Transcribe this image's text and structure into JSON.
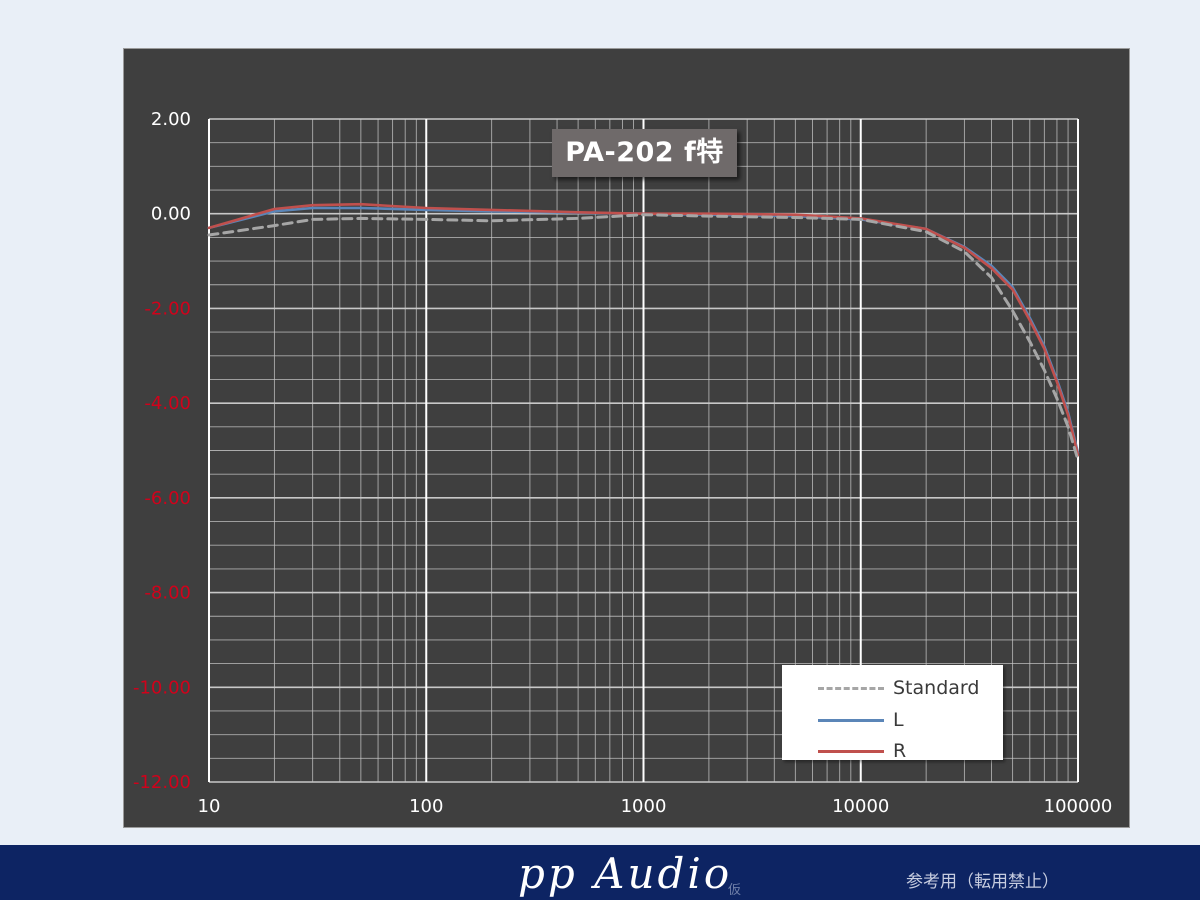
{
  "chart_data": {
    "type": "line",
    "title": "PA-202  f特",
    "x_scale": "log",
    "xlim": [
      10,
      100000
    ],
    "ylim": [
      -12,
      2
    ],
    "x_ticks": [
      "10",
      "100",
      "1000",
      "10000",
      "100000"
    ],
    "y_ticks": [
      {
        "value": 2,
        "label": "2.00",
        "color": "#ffffff"
      },
      {
        "value": 0,
        "label": "0.00",
        "color": "#ffffff"
      },
      {
        "value": -2,
        "label": "-2.00",
        "color": "#d0021b"
      },
      {
        "value": -4,
        "label": "-4.00",
        "color": "#d0021b"
      },
      {
        "value": -6,
        "label": "-6.00",
        "color": "#d0021b"
      },
      {
        "value": -8,
        "label": "-8.00",
        "color": "#d0021b"
      },
      {
        "value": -10,
        "label": "-10.00",
        "color": "#d0021b"
      },
      {
        "value": -12,
        "label": "-12.00",
        "color": "#d0021b"
      }
    ],
    "grid": true,
    "legend_position": "bottom-right",
    "series": [
      {
        "name": "Standard",
        "color": "#a6a6a6",
        "dash": true,
        "x": [
          10,
          20,
          30,
          50,
          100,
          200,
          500,
          1000,
          2000,
          5000,
          10000,
          20000,
          30000,
          40000,
          50000,
          60000,
          70000,
          80000,
          90000,
          100000
        ],
        "y": [
          -0.45,
          -0.25,
          -0.12,
          -0.1,
          -0.12,
          -0.15,
          -0.1,
          -0.02,
          -0.05,
          -0.08,
          -0.12,
          -0.38,
          -0.8,
          -1.35,
          -2.05,
          -2.7,
          -3.3,
          -3.9,
          -4.5,
          -5.2
        ]
      },
      {
        "name": "L",
        "color": "#5b86b8",
        "dash": false,
        "x": [
          10,
          20,
          30,
          50,
          100,
          200,
          500,
          1000,
          2000,
          5000,
          10000,
          20000,
          30000,
          40000,
          50000,
          60000,
          70000,
          80000,
          90000,
          100000
        ],
        "y": [
          -0.3,
          0.05,
          0.12,
          0.12,
          0.08,
          0.05,
          0.02,
          0.0,
          -0.02,
          -0.05,
          -0.12,
          -0.32,
          -0.7,
          -1.1,
          -1.55,
          -2.2,
          -2.8,
          -3.5,
          -4.2,
          -5.05
        ]
      },
      {
        "name": "R",
        "color": "#c0504d",
        "dash": false,
        "x": [
          10,
          20,
          30,
          50,
          100,
          200,
          500,
          1000,
          2000,
          5000,
          10000,
          20000,
          30000,
          40000,
          50000,
          60000,
          70000,
          80000,
          90000,
          100000
        ],
        "y": [
          -0.3,
          0.1,
          0.18,
          0.2,
          0.12,
          0.08,
          0.03,
          0.0,
          0.0,
          -0.02,
          -0.1,
          -0.32,
          -0.72,
          -1.15,
          -1.6,
          -2.25,
          -2.85,
          -3.55,
          -4.25,
          -5.1
        ]
      }
    ]
  },
  "chart_bg": "#3f3f3f",
  "grid_color": "#c8c8c8",
  "footer": {
    "brand": "pp Audio",
    "brand_sub": "仮",
    "note": "参考用（転用禁止）",
    "bar_color": "#0d2463"
  }
}
